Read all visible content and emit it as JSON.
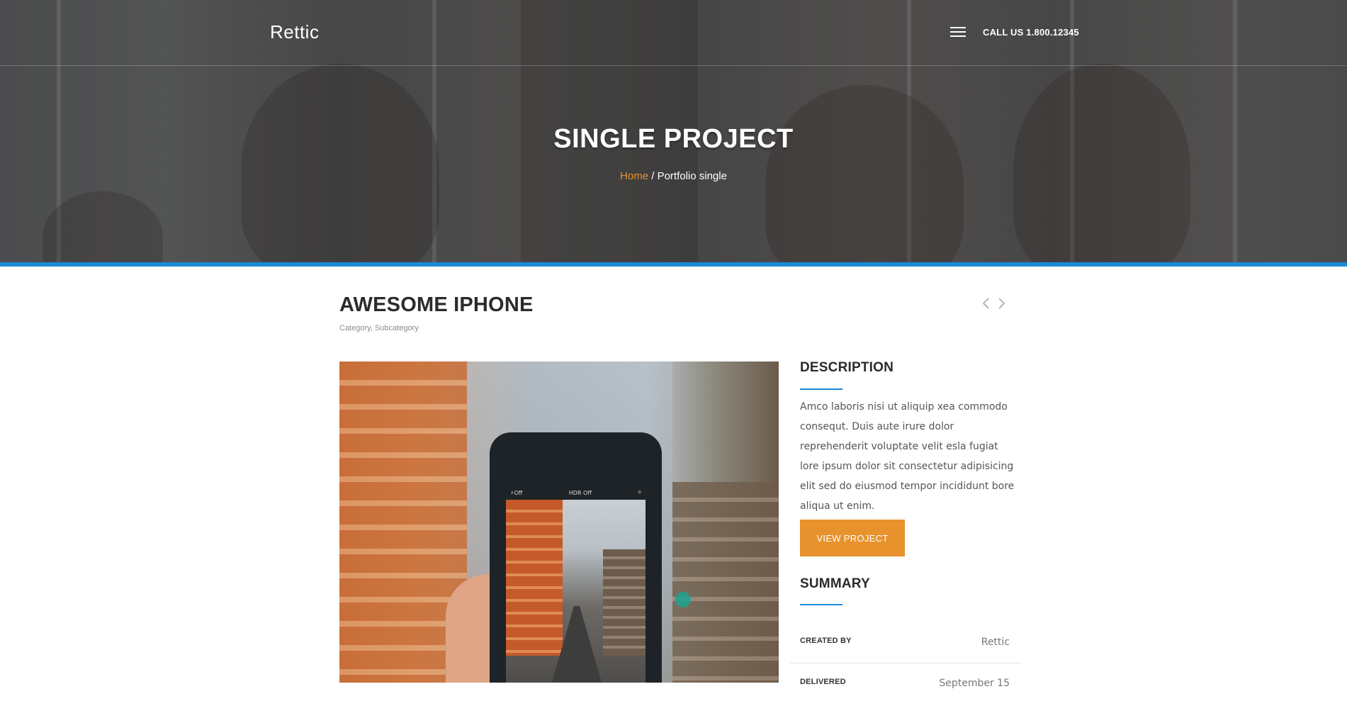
{
  "header": {
    "logo": "Rettic",
    "menu_icon": "hamburger-menu-icon",
    "call_text": "CALL US 1.800.12345"
  },
  "hero": {
    "title": "SINGLE PROJECT",
    "breadcrumb_home": "Home",
    "breadcrumb_separator": " / ",
    "breadcrumb_current": "Portfolio single",
    "accent_bar_color": "#1a8bd6"
  },
  "project": {
    "title": "AWESOME IPHONE",
    "category": "Category",
    "category_separator": ", ",
    "subcategory": "Subcategory",
    "prev_icon": "chevron-left-icon",
    "next_icon": "chevron-right-icon",
    "image_phone_status": {
      "flash": "⚡Off",
      "hdr": "HDR Off"
    }
  },
  "description": {
    "heading": "DESCRIPTION",
    "text": "Amco laboris nisi ut aliquip xea commodo consequt. Duis aute irure dolor reprehenderit voluptate velit esla fugiat lore ipsum dolor sit consectetur adipisicing elit sed do eiusmod tempor incididunt bore aliqua ut enim.",
    "button_label": "VIEW PROJECT",
    "button_color": "#e8922e"
  },
  "summary": {
    "heading": "SUMMARY",
    "rows": [
      {
        "key": "CREATED BY",
        "value": "Rettic"
      },
      {
        "key": "DELIVERED",
        "value": "September 15"
      }
    ]
  }
}
